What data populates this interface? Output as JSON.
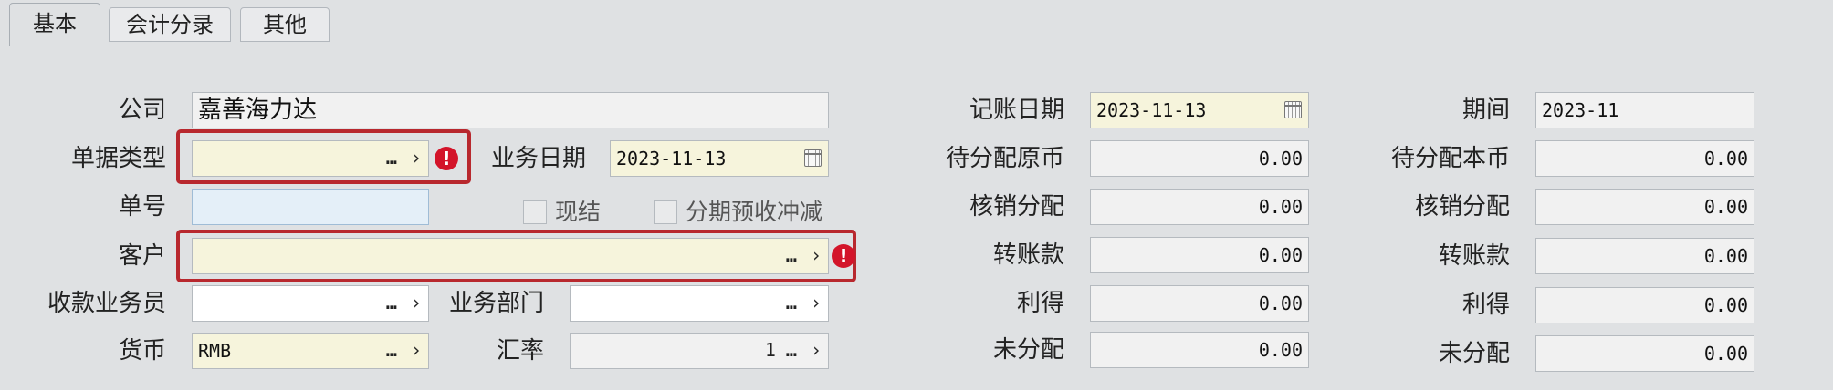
{
  "tabs": [
    {
      "label": "基本",
      "active": true
    },
    {
      "label": "会计分录",
      "active": false
    },
    {
      "label": "其他",
      "active": false
    }
  ],
  "form": {
    "company": {
      "label": "公司",
      "value": "嘉善海力达"
    },
    "doc_type": {
      "label": "单据类型",
      "value": ""
    },
    "biz_date": {
      "label": "业务日期",
      "value": "2023-11-13"
    },
    "doc_no": {
      "label": "单号",
      "value": ""
    },
    "settled": {
      "label": "现结",
      "checked": false
    },
    "installment": {
      "label": "分期预收冲减",
      "checked": false
    },
    "customer": {
      "label": "客户",
      "value": ""
    },
    "collector": {
      "label": "收款业务员",
      "value": ""
    },
    "dept": {
      "label": "业务部门",
      "value": ""
    },
    "currency": {
      "label": "货币",
      "value": "RMB"
    },
    "rate": {
      "label": "汇率",
      "value": "1"
    },
    "posting_date": {
      "label": "记账日期",
      "value": "2023-11-13"
    },
    "period": {
      "label": "期间",
      "value": "2023-11"
    },
    "col2": [
      {
        "label": "待分配原币",
        "value": "0.00"
      },
      {
        "label": "核销分配",
        "value": "0.00"
      },
      {
        "label": "转账款",
        "value": "0.00"
      },
      {
        "label": "利得",
        "value": "0.00"
      },
      {
        "label": "未分配",
        "value": "0.00"
      }
    ],
    "col3": [
      {
        "label": "待分配本币",
        "value": "0.00"
      },
      {
        "label": "核销分配",
        "value": "0.00"
      },
      {
        "label": "转账款",
        "value": "0.00"
      },
      {
        "label": "利得",
        "value": "0.00"
      },
      {
        "label": "未分配",
        "value": "0.00"
      }
    ]
  },
  "icons": {
    "ellipsis": "…",
    "chevron": "›",
    "warning": "!"
  },
  "colors": {
    "required_outline": "#b8282e",
    "warning_icon": "#d3142a",
    "required_field_bg": "#f6f4dc"
  }
}
